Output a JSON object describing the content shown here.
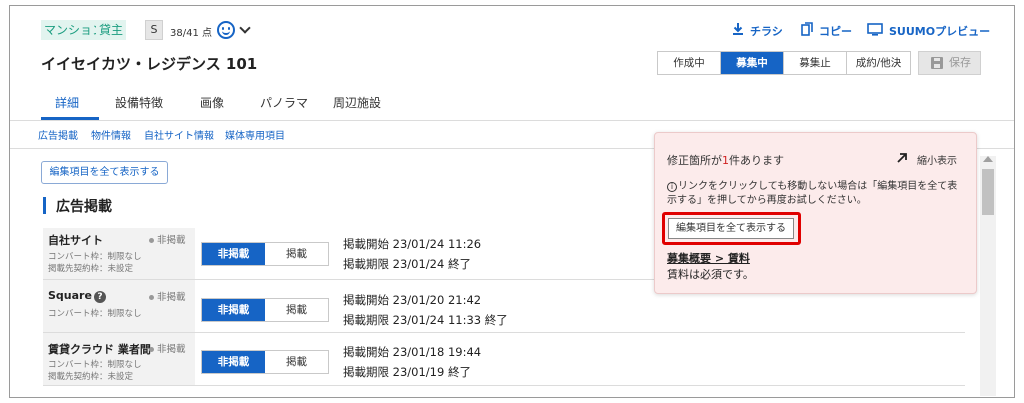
{
  "header": {
    "property_type": "マンション",
    "role": "貸主",
    "rank": "S",
    "score": "38/41 点",
    "links": {
      "flyer": "チラシ",
      "copy": "コピー",
      "preview": "SUUMOプレビュー"
    },
    "title": "イイセイカツ・レジデンス 101",
    "status_buttons": [
      {
        "label": "作成中",
        "active": false
      },
      {
        "label": "募集中",
        "active": true
      },
      {
        "label": "募集止",
        "active": false
      },
      {
        "label": "成約/他決",
        "active": false
      }
    ],
    "save_label": "保存"
  },
  "tabs": [
    {
      "label": "詳細",
      "active": true
    },
    {
      "label": "設備特徴",
      "active": false
    },
    {
      "label": "画像",
      "active": false
    },
    {
      "label": "パノラマ",
      "active": false
    },
    {
      "label": "周辺施設",
      "active": false
    }
  ],
  "sublinks": [
    "広告掲載",
    "物件情報",
    "自社サイト情報",
    "媒体専用項目"
  ],
  "show_all_label": "編集項目を全て表示する",
  "section_title": "広告掲載",
  "rows": [
    {
      "name": "自社サイト",
      "status": "非掲載",
      "sub1": "コンバート枠：制限なし",
      "sub2": "掲載先契約枠：未設定",
      "toggle_off": "非掲載",
      "toggle_on": "掲載",
      "start": "掲載開始 23/01/24 11:26",
      "end": "掲載期限 23/01/24 終了"
    },
    {
      "name": "Square",
      "status": "非掲載",
      "sub1": "コンバート枠：制限なし",
      "toggle_off": "非掲載",
      "toggle_on": "掲載",
      "start": "掲載開始 23/01/20 21:42",
      "end": "掲載期限 23/01/24 11:33 終了"
    },
    {
      "name": "賃貸クラウド 業者間",
      "status": "非掲載",
      "sub1": "コンバート枠：制限なし",
      "sub2": "掲載先契約枠：未設定",
      "toggle_off": "非掲載",
      "toggle_on": "掲載",
      "start": "掲載開始 23/01/18 19:44",
      "end": "掲載期限 23/01/19 終了"
    }
  ],
  "panel": {
    "title_pre": "修正箇所が",
    "title_num": "1",
    "title_post": "件あります",
    "shrink": "縮小表示",
    "note": "リンクをクリックしても移動しない場合は「編集項目を全て表示する」を押してから再度お試しください。",
    "button": "編集項目を全て表示する",
    "link": "募集概要 > 賃料",
    "message": "賃料は必須です。"
  },
  "colors": {
    "accent": "#1664c5",
    "tag_green": "#1a9c7f",
    "alert_red": "#e00000",
    "panel_bg": "#fcebeb"
  }
}
